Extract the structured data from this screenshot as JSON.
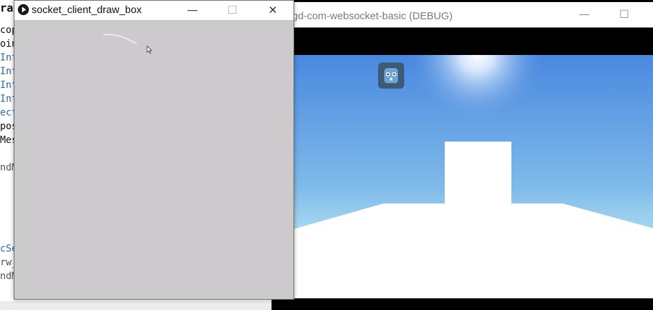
{
  "editor": {
    "title_fragment": "rav",
    "lines": [
      {
        "text": "cop",
        "color": "#111111"
      },
      {
        "text": "oin",
        "color": "#111111"
      },
      {
        "text": "Int",
        "color": "#2a6aa8"
      },
      {
        "text": "Int",
        "color": "#2a6aa8"
      },
      {
        "text": "Int",
        "color": "#2a6aa8"
      },
      {
        "text": "Int",
        "color": "#2a6aa8"
      },
      {
        "text": "ect",
        "color": "#2a6aa8"
      },
      {
        "text": "pos",
        "color": "#111111"
      },
      {
        "text": "Mes",
        "color": "#111111"
      },
      {
        "text": "ndM",
        "color": "#555555"
      },
      {
        "text": "cSe",
        "color": "#2a6aa8"
      },
      {
        "text": "rw_",
        "color": "#555555"
      },
      {
        "text": "ndM",
        "color": "#555555"
      }
    ]
  },
  "game_window": {
    "title": "gd-com-websocket-basic (DEBUG)",
    "minimize_icon": "minimize-icon",
    "maximize_icon": "maximize-icon",
    "colors": {
      "sky_top": "#4a88e0",
      "sky_horizon": "#9fd0ee",
      "ground_dark": "#2c3a4a",
      "floor": "#ffffff"
    }
  },
  "client_window": {
    "title": "socket_client_draw_box",
    "app_icon": "play-icon",
    "minimize_icon": "minimize-icon",
    "maximize_icon": "maximize-icon",
    "close_icon": "close-icon",
    "canvas_color": "#cccacd"
  }
}
